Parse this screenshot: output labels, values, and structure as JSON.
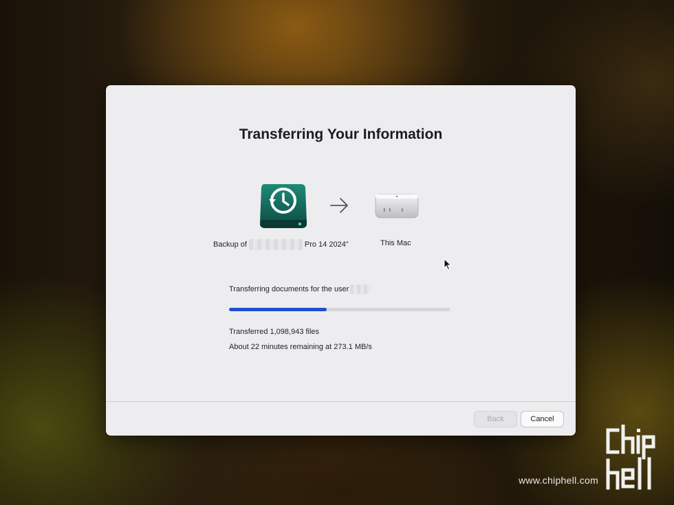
{
  "window": {
    "title": "Transferring Your Information"
  },
  "transfer": {
    "source_label_prefix": "Backup of",
    "source_label_suffix": "Pro 14 2024\"",
    "source_icon": "time-machine-drive-icon",
    "arrow_icon": "arrow-right-icon",
    "destination_label": "This Mac",
    "destination_icon": "mac-mini-icon"
  },
  "progress": {
    "status_text": "Transferring documents for the user",
    "fraction": 0.44,
    "accent_color": "#1f4fd1",
    "files_text": "Transferred 1,098,943 files",
    "time_text": "About 22 minutes remaining at 273.1 MB/s"
  },
  "footer": {
    "back_label": "Back",
    "cancel_label": "Cancel"
  },
  "watermark": {
    "logo_text": "chip hell",
    "site_text": "www.chiphell.com"
  }
}
